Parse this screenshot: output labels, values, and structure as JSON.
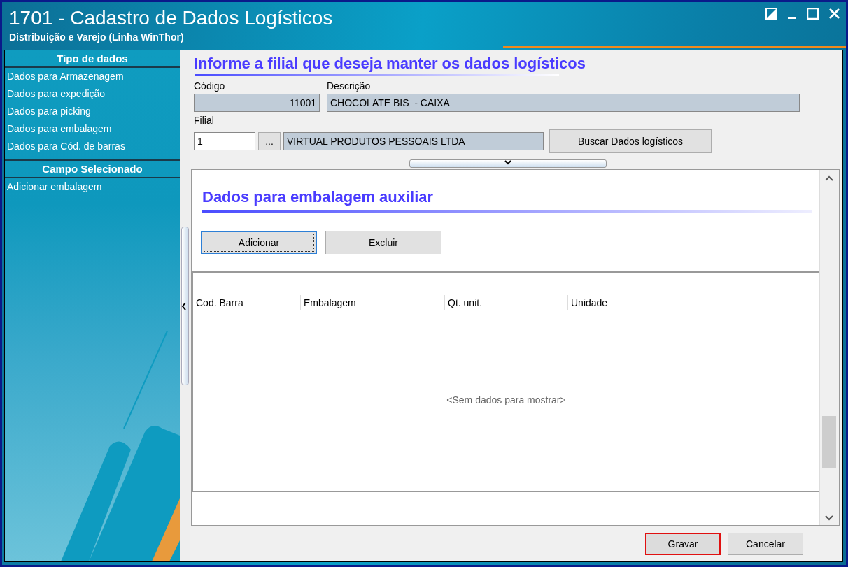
{
  "window": {
    "title": "1701 - Cadastro de Dados Logísticos",
    "subtitle": "Distribuição e Varejo (Linha WinThor)"
  },
  "sidebar": {
    "sections": [
      {
        "title": "Tipo de dados",
        "items": [
          {
            "label": "Dados para Armazenagem"
          },
          {
            "label": "Dados para expedição"
          },
          {
            "label": "Dados para picking"
          },
          {
            "label": "Dados para embalagem"
          },
          {
            "label": "Dados para Cód. de barras"
          }
        ]
      },
      {
        "title": "Campo Selecionado",
        "items": [
          {
            "label": "Adicionar embalagem"
          }
        ]
      }
    ]
  },
  "header": {
    "title": "Informe a filial que deseja manter os dados logísticos",
    "codigo": {
      "label": "Código",
      "value": "11001"
    },
    "descricao": {
      "label": "Descrição",
      "value": "CHOCOLATE BIS  - CAIXA"
    },
    "filial": {
      "label": "Filial",
      "value": "1",
      "lookup": "...",
      "name": "VIRTUAL PRODUTOS PESSOAIS LTDA"
    },
    "search_button": "Buscar Dados logísticos"
  },
  "section": {
    "title": "Dados para embalagem auxiliar",
    "buttons": [
      {
        "label": "Adicionar",
        "focused": true
      },
      {
        "label": "Excluir",
        "focused": false
      }
    ],
    "table": {
      "columns": [
        "Cod. Barra",
        "Embalagem",
        "Qt. unit.",
        "Unidade"
      ],
      "empty_text": "<Sem dados para mostrar>"
    }
  },
  "footer": {
    "buttons": [
      {
        "label": "Gravar",
        "highlighted": true
      },
      {
        "label": "Cancelar",
        "highlighted": false
      }
    ]
  }
}
